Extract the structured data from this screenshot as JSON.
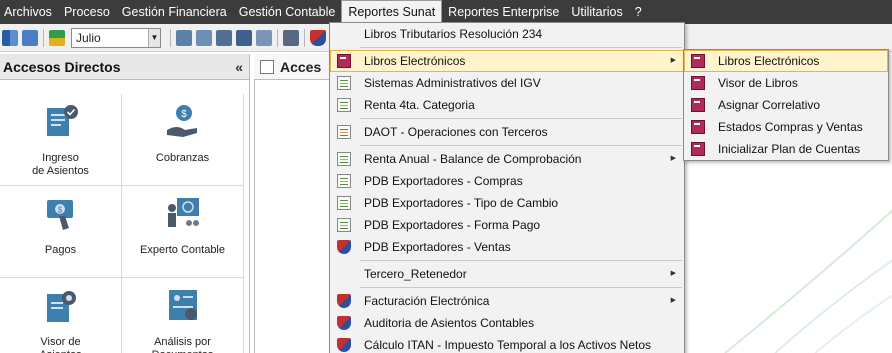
{
  "menubar": {
    "items": [
      "Archivos",
      "Proceso",
      "Gestión Financiera",
      "Gestión Contable",
      "Reportes Sunat",
      "Reportes Enterprise",
      "Utilitarios",
      "?"
    ]
  },
  "toolbar": {
    "month_value": "Julio",
    "partial_label": "Ac"
  },
  "left_panel": {
    "title": "Accesos Directos",
    "collapse_glyph": "«",
    "tiles": [
      "Ingreso\nde Asientos",
      "Cobranzas",
      "Pagos",
      "Experto Contable",
      "Visor de\nAsientos",
      "Análisis por\nDocumentos"
    ]
  },
  "main_header": {
    "title": "Acces"
  },
  "reportes_sunat_menu": {
    "items": [
      {
        "label": "Libros Tributarios Resolución 234",
        "icon": "none"
      },
      {
        "label": "Libros Electrónicos",
        "icon": "book-icon",
        "submenu": true,
        "highlighted": true
      },
      {
        "label": "Sistemas Administrativos del IGV",
        "icon": "document-icon"
      },
      {
        "label": "Renta 4ta. Categoria",
        "icon": "document-icon"
      },
      {
        "label": "DAOT - Operaciones con Terceros",
        "icon": "document-icon"
      },
      {
        "label": "Renta Anual - Balance de Comprobación",
        "icon": "document-icon",
        "submenu": true
      },
      {
        "label": "PDB Exportadores - Compras",
        "icon": "document-icon"
      },
      {
        "label": "PDB Exportadores - Tipo de Cambio",
        "icon": "document-icon"
      },
      {
        "label": "PDB Exportadores - Forma Pago",
        "icon": "document-icon"
      },
      {
        "label": "PDB Exportadores - Ventas",
        "icon": "shield-icon"
      },
      {
        "label": "Tercero_Retenedor",
        "icon": "none",
        "submenu": true
      },
      {
        "label": "Facturación Electrónica",
        "icon": "shield-icon",
        "submenu": true
      },
      {
        "label": "Auditoria de Asientos Contables",
        "icon": "shield-icon"
      },
      {
        "label": "Cálculo ITAN - Impuesto Temporal a los Activos Netos",
        "icon": "shield-icon"
      }
    ]
  },
  "libros_submenu": {
    "items": [
      {
        "label": "Libros Electrónicos",
        "highlighted": true
      },
      {
        "label": "Visor de Libros"
      },
      {
        "label": "Asignar Correlativo"
      },
      {
        "label": "Estados Compras y Ventas"
      },
      {
        "label": "Inicializar Plan de Cuentas"
      }
    ]
  },
  "colors": {
    "menubar_bg": "#3c3c3c",
    "highlight_bg": "#fff4cc",
    "highlight_border": "#e8b44a",
    "tile_icon_blue": "#3f7fae"
  }
}
